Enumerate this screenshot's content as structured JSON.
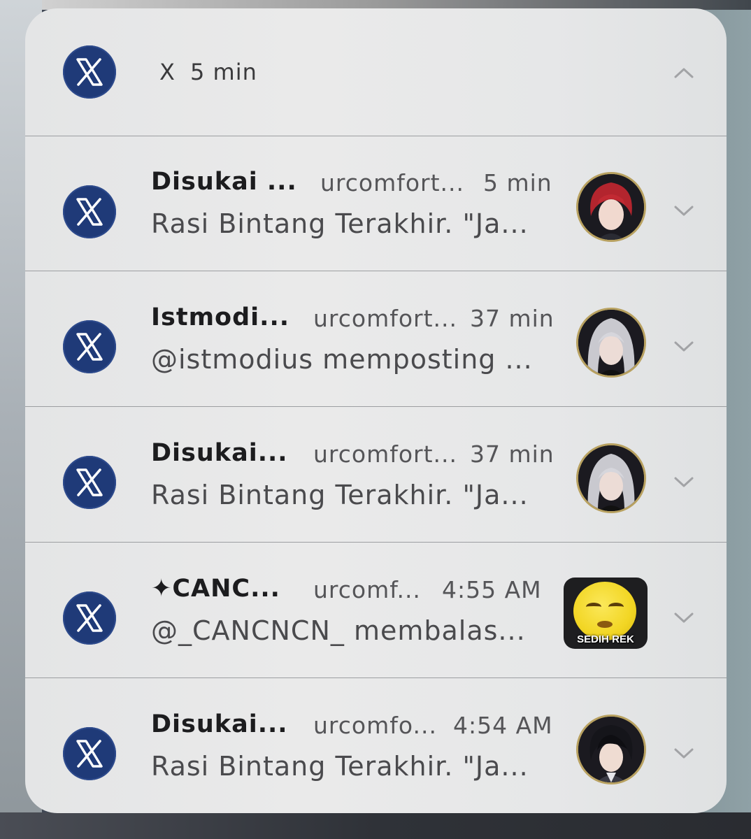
{
  "group_header": {
    "app_name": "X",
    "time": "5 min",
    "app_icon": "x-logo-icon",
    "collapse_icon": "chevron-up-icon"
  },
  "notifications": [
    {
      "title": "Disukai ...",
      "account": "urcomfort...",
      "time": "5 min",
      "body": "Rasi Bintang Terakhir.  \"Ja...",
      "avatar": "red-haired-character-avatar"
    },
    {
      "title": "Istmodi...",
      "account": "urcomfort...",
      "time": "37 min",
      "body": "@istmodius memposting ...",
      "avatar": "silver-haired-character-avatar"
    },
    {
      "title": "Disukai...",
      "account": "urcomfort...",
      "time": "37 min",
      "body": "Rasi Bintang Terakhir.  \"Ja...",
      "avatar": "silver-haired-character-avatar"
    },
    {
      "title": "✦CANC...",
      "account": "urcomf...",
      "time": "4:55 AM",
      "body": "@_CANCNCN_ membalas...",
      "avatar": "crying-emoji-thumbnail",
      "thumb_caption": "SEDIH REK"
    },
    {
      "title": "Disukai...",
      "account": "urcomfo...",
      "time": "4:54 AM",
      "body": "Rasi Bintang Terakhir.  \"Ja...",
      "avatar": "dark-haired-character-avatar"
    }
  ],
  "colors": {
    "x_icon_bg": "#1f3a78",
    "avatar_ring": "#b8a160",
    "panel_bg": "#e7e8e9"
  }
}
